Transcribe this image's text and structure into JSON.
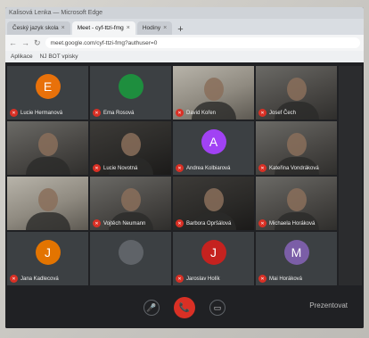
{
  "browser": {
    "title": "Kalisová Lenka — Microsoft Edge",
    "tabs": [
      {
        "label": "Český jazyk skola",
        "active": false
      },
      {
        "label": "Meet - cyf-ttzi-fmg",
        "active": true
      },
      {
        "label": "Hodiny",
        "active": false
      }
    ],
    "url": "meet.google.com/cyf-ttzi-fmg?authuser=0",
    "bookmarks": [
      "Aplikace",
      "NJ BOT vpisky"
    ]
  },
  "participants": [
    {
      "name": "Lucie Hermanová",
      "kind": "avatar",
      "initial": "E",
      "color": "#e8710a"
    },
    {
      "name": "Ema Rosová",
      "kind": "avatar",
      "initial": "",
      "color": "#1e8e3e"
    },
    {
      "name": "David Kořen",
      "kind": "video",
      "tone": "light"
    },
    {
      "name": "Josef Čech",
      "kind": "video",
      "tone": ""
    },
    {
      "name": "",
      "kind": "video",
      "tone": ""
    },
    {
      "name": "Lucie Novotná",
      "kind": "video",
      "tone": "dark"
    },
    {
      "name": "Andrea Kolbiarová",
      "kind": "avatar",
      "initial": "A",
      "color": "#a142f4"
    },
    {
      "name": "Kateřina Vondráková",
      "kind": "video",
      "tone": ""
    },
    {
      "name": "",
      "kind": "video",
      "tone": "light"
    },
    {
      "name": "Vojtěch Neumann",
      "kind": "video",
      "tone": ""
    },
    {
      "name": "Barbora Opršálová",
      "kind": "video",
      "tone": "dark"
    },
    {
      "name": "Michaela Horáková",
      "kind": "video",
      "tone": ""
    },
    {
      "name": "Jana Kadlecová",
      "kind": "avatar",
      "initial": "J",
      "color": "#e37400"
    },
    {
      "name": "",
      "kind": "avatar",
      "initial": "",
      "color": "#5f6368"
    },
    {
      "name": "Jaroslav Holík",
      "kind": "avatar",
      "initial": "J",
      "color": "#c5221f"
    },
    {
      "name": "Mai Horáková",
      "kind": "avatar",
      "initial": "M",
      "color": "#7b5ea7"
    }
  ],
  "controls": {
    "mic": "🎤",
    "hangup": "📞",
    "camera": "▭",
    "present": "Prezentovat"
  },
  "icons": {
    "mic_muted": "mic-off-icon",
    "back": "back-icon",
    "forward": "forward-icon",
    "reload": "reload-icon"
  }
}
